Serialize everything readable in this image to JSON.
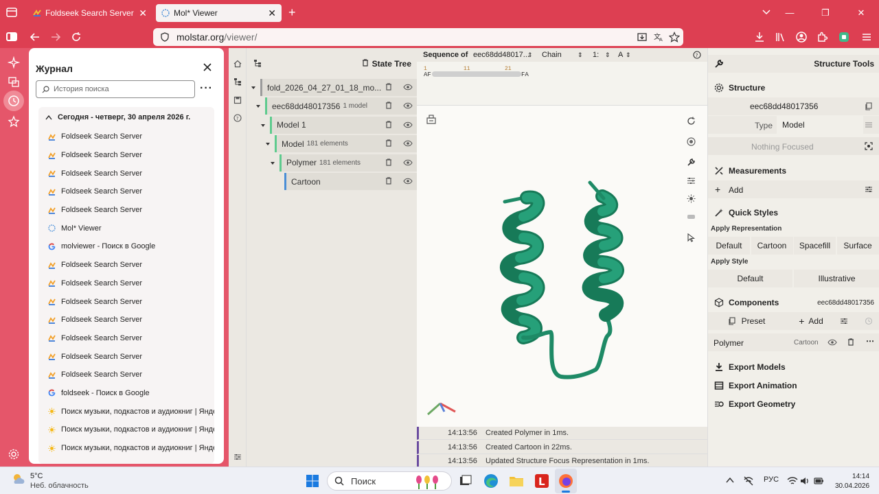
{
  "browser": {
    "tabs": [
      {
        "title": "Foldseek Search Server"
      },
      {
        "title": "Mol* Viewer"
      }
    ],
    "url_host": "molstar.org",
    "url_path": "/viewer/"
  },
  "history": {
    "title": "Журнал",
    "search_placeholder": "История поиска",
    "group_label": "Сегодня - четверг, 30 апреля 2026 г.",
    "items": [
      {
        "title": "Foldseek Search Server",
        "icon": "foldseek-icon"
      },
      {
        "title": "Foldseek Search Server",
        "icon": "foldseek-icon"
      },
      {
        "title": "Foldseek Search Server",
        "icon": "foldseek-icon"
      },
      {
        "title": "Foldseek Search Server",
        "icon": "foldseek-icon"
      },
      {
        "title": "Foldseek Search Server",
        "icon": "foldseek-icon"
      },
      {
        "title": "Mol* Viewer",
        "icon": "molstar-icon"
      },
      {
        "title": "molviewer - Поиск в Google",
        "icon": "google-icon"
      },
      {
        "title": "Foldseek Search Server",
        "icon": "foldseek-icon"
      },
      {
        "title": "Foldseek Search Server",
        "icon": "foldseek-icon"
      },
      {
        "title": "Foldseek Search Server",
        "icon": "foldseek-icon"
      },
      {
        "title": "Foldseek Search Server",
        "icon": "foldseek-icon"
      },
      {
        "title": "Foldseek Search Server",
        "icon": "foldseek-icon"
      },
      {
        "title": "Foldseek Search Server",
        "icon": "foldseek-icon"
      },
      {
        "title": "Foldseek Search Server",
        "icon": "foldseek-icon"
      },
      {
        "title": "foldseek - Поиск в Google",
        "icon": "google-icon"
      },
      {
        "title": "Поиск музыки, подкастов и аудиокниг | Янде...",
        "icon": "yandex-music-icon"
      },
      {
        "title": "Поиск музыки, подкастов и аудиокниг | Янде...",
        "icon": "yandex-music-icon"
      },
      {
        "title": "Поиск музыки, подкастов и аудиокниг | Янде...",
        "icon": "yandex-music-icon"
      }
    ]
  },
  "state_tree": {
    "title": "State Tree",
    "nodes": [
      {
        "label": "fold_2026_04_27_01_18_mo...",
        "sub": ""
      },
      {
        "label": "eec68dd48017356",
        "sub": "1 model"
      },
      {
        "label": "Model 1",
        "sub": ""
      },
      {
        "label": "Model",
        "sub": "181 elements"
      },
      {
        "label": "Polymer",
        "sub": "181 elements"
      },
      {
        "label": "Cartoon",
        "sub": ""
      }
    ]
  },
  "sequence": {
    "label": "Sequence of",
    "entity": "eec68dd48017...",
    "mode": "Chain",
    "index": "1:",
    "chain": "A",
    "numbers": [
      "1",
      "11",
      "21"
    ],
    "start": "AF",
    "end": "FA"
  },
  "log": [
    {
      "time": "14:13:56",
      "message": "Created Polymer in 1ms."
    },
    {
      "time": "14:13:56",
      "message": "Created Cartoon in 22ms."
    },
    {
      "time": "14:13:56",
      "message": "Updated Structure Focus Representation in 1ms."
    }
  ],
  "tools": {
    "title": "Structure Tools",
    "structure": {
      "header": "Structure",
      "name": "eec68dd48017356",
      "type_label": "Type",
      "type_value": "Model",
      "focus": "Nothing Focused"
    },
    "measurements": {
      "header": "Measurements",
      "add": "Add"
    },
    "quick_styles": {
      "header": "Quick Styles",
      "apply_representation": "Apply Representation",
      "representations": [
        "Default",
        "Cartoon",
        "Spacefill",
        "Surface"
      ],
      "apply_style": "Apply Style",
      "styles": [
        "Default",
        "Illustrative"
      ]
    },
    "components": {
      "header": "Components",
      "name": "eec68dd48017356",
      "preset": "Preset",
      "add": "Add",
      "polymer": "Polymer",
      "polymer_repr": "Cartoon"
    },
    "exports": [
      "Export Models",
      "Export Animation",
      "Export Geometry"
    ]
  },
  "taskbar": {
    "temperature": "5°C",
    "weather": "Неб. облачность",
    "search": "Поиск",
    "lang": "РУС",
    "time": "14:14",
    "date": "30.04.2026"
  },
  "colors": {
    "accent": "#dd3f52",
    "protein": "#1e8a66"
  }
}
